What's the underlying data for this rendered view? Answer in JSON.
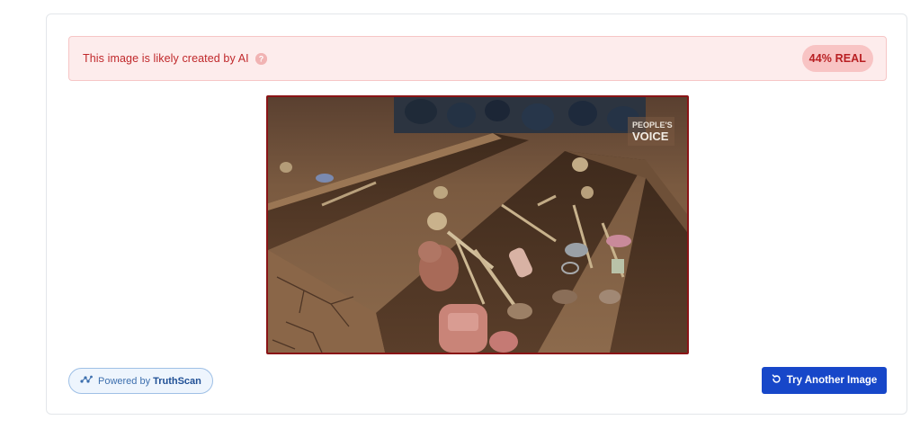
{
  "result": {
    "verdict_text": "This image is likely created by AI",
    "score_label": "44% REAL",
    "status_color": "#c0282b"
  },
  "image": {
    "watermark_line1": "PEOPLE'S",
    "watermark_line2": "VOICE"
  },
  "footer": {
    "powered_prefix": "Powered by",
    "powered_brand": "TruthScan",
    "try_another_label": "Try Another Image"
  },
  "colors": {
    "accent": "#1747c9",
    "banner_bg": "#fdecec",
    "badge_bg": "#f8c4c4"
  },
  "icons": {
    "help": "question-circle-icon",
    "brand": "truthscan-logo-icon",
    "retry": "rotate-ccw-icon"
  }
}
